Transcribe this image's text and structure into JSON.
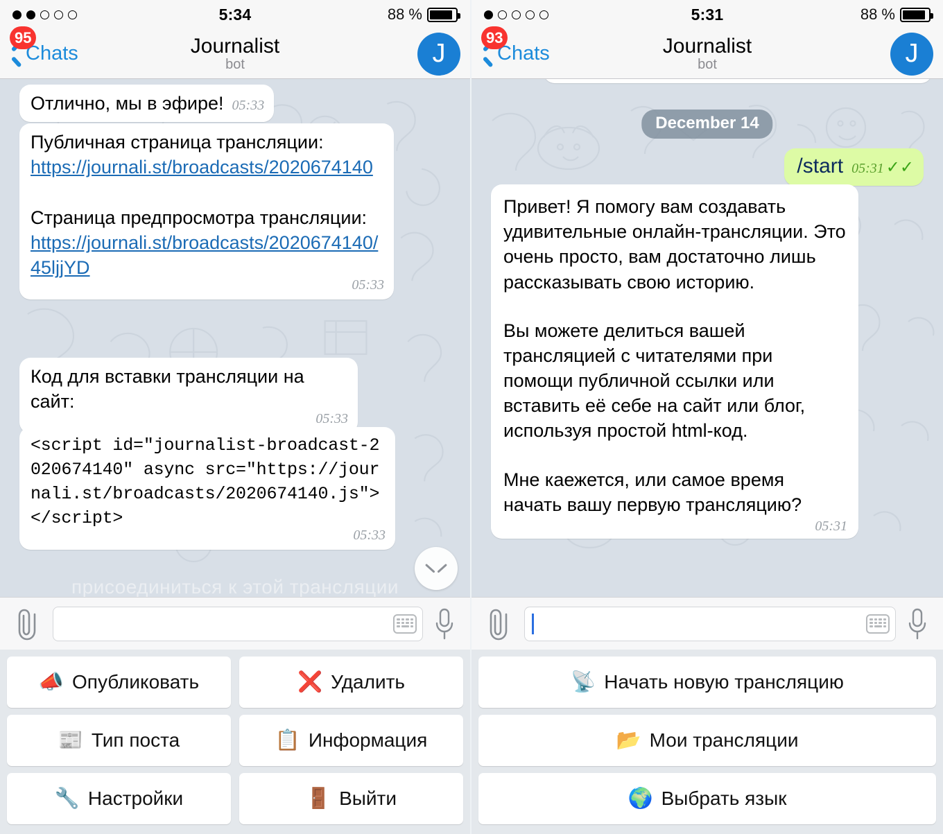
{
  "panels": [
    {
      "id": "left",
      "status": {
        "signal_dots": 5,
        "signal_filled": 2,
        "time": "5:34",
        "battery_pct": "88 %",
        "battery_level": 88
      },
      "nav": {
        "back_label": "Chats",
        "badge": "95",
        "title": "Journalist",
        "subtitle": "bot",
        "avatar_letter": "J"
      },
      "messages": [
        {
          "kind": "in",
          "text": "Отлично, мы в эфире!",
          "time": "05:33",
          "time_pos": "inline"
        },
        {
          "kind": "in-links",
          "line1": "Публичная страница трансляции:",
          "link1": "https://journali.st/broadcasts/2020674140",
          "line2": "Страница предпросмотра трансляции:",
          "link2": "https://journali.st/broadcasts/2020674140/45ljjYD",
          "time": "05:33",
          "time_pos": "right"
        },
        {
          "kind": "in",
          "text": "Код для вставки трансляции на сайт:",
          "time": "05:33",
          "time_pos": "right"
        },
        {
          "kind": "code",
          "text": "<script id=\"journalist-broadcast-2020674140\" async src=\"https://journali.st/broadcasts/2020674140.js\"></script>",
          "time": "05:33",
          "time_pos": "right"
        }
      ],
      "ghost_text": "присоединиться к этой трансляции",
      "scroll_button": "scroll-to-bottom",
      "composer": {
        "value": "",
        "placeholder": "",
        "caret": false
      },
      "keyboard_rows": [
        [
          {
            "emoji": "📣",
            "icon": "megaphone-icon",
            "label": "Опубликовать"
          },
          {
            "emoji": "❌",
            "icon": "cross-mark-icon",
            "label": "Удалить"
          }
        ],
        [
          {
            "emoji": "📰",
            "icon": "newspaper-icon",
            "label": "Тип поста"
          },
          {
            "emoji": "📋",
            "icon": "clipboard-icon",
            "label": "Информация"
          }
        ],
        [
          {
            "emoji": "🔧",
            "icon": "wrench-icon",
            "label": "Настройки"
          },
          {
            "emoji": "🚪",
            "icon": "door-icon",
            "label": "Выйти"
          }
        ]
      ]
    },
    {
      "id": "right",
      "status": {
        "signal_dots": 5,
        "signal_filled": 1,
        "time": "5:31",
        "battery_pct": "88 %",
        "battery_level": 88
      },
      "nav": {
        "back_label": "Chats",
        "badge": "93",
        "title": "Journalist",
        "subtitle": "bot",
        "avatar_letter": "J"
      },
      "date_chip": "December 14",
      "messages": [
        {
          "kind": "out",
          "text": "/start",
          "time": "05:31",
          "checks": "✓✓"
        },
        {
          "kind": "in-long",
          "paragraphs": [
            "Привет! Я помогу вам создавать удивительные онлайн-трансляции. Это очень просто, вам достаточно лишь рассказывать свою историю.",
            "Вы можете делиться вашей трансляцией с читателями при помощи публичной ссылки или вставить её себе на сайт или блог, используя простой html-код.",
            "Мне каежется, или самое время начать вашу первую трансляцию?"
          ],
          "time": "05:31",
          "time_pos": "right"
        }
      ],
      "composer": {
        "value": "",
        "placeholder": "",
        "caret": true
      },
      "keyboard_rows": [
        [
          {
            "emoji": "📡",
            "icon": "satellite-antenna-icon",
            "label": "Начать новую трансляцию"
          }
        ],
        [
          {
            "emoji": "📂",
            "icon": "open-folder-icon",
            "label": "Мои трансляции"
          }
        ],
        [
          {
            "emoji": "🌍",
            "icon": "globe-icon",
            "label": "Выбрать язык"
          }
        ]
      ]
    }
  ],
  "colors": {
    "accent_blue": "#1c8bdb",
    "badge_red": "#f8332f",
    "outgoing_green": "#ddfba5",
    "chat_background": "#d8dfe7",
    "avatar_blue": "#1a7fd4",
    "link_blue": "#1b6bb5"
  }
}
